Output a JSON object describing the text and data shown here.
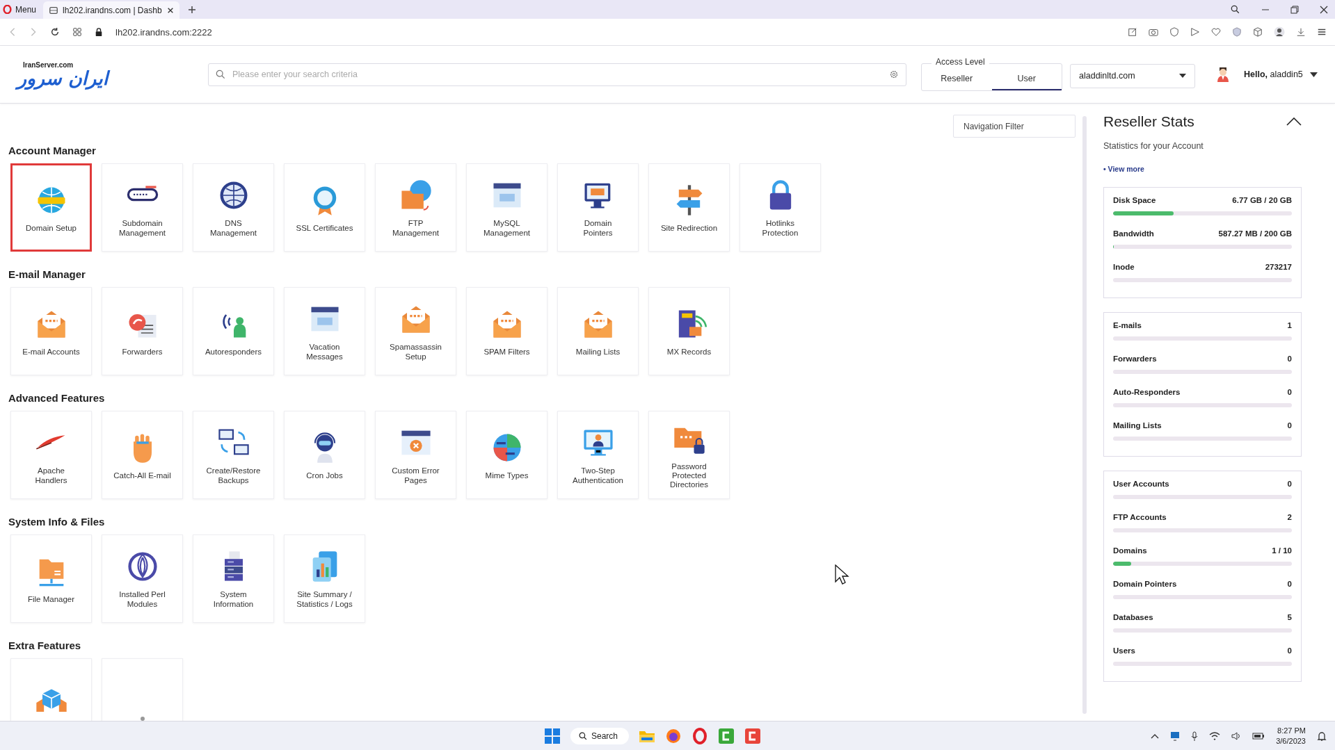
{
  "browser": {
    "menu_label": "Menu",
    "tab_title": "lh202.irandns.com | Dashb",
    "url": "lh202.irandns.com:2222"
  },
  "header": {
    "logo_caption": "IranServer.com",
    "logo_text": "ایران سرور",
    "search": {
      "placeholder": "Please enter your search criteria"
    },
    "access_level": {
      "legend": "Access Level",
      "options": [
        {
          "label": "Reseller",
          "selected": false
        },
        {
          "label": "User",
          "selected": true
        }
      ]
    },
    "domain_select": {
      "value": "aladdinltd.com"
    },
    "greeting": "**Hello,** aladdin5"
  },
  "navigation_filter": {
    "placeholder": "Navigation Filter"
  },
  "sections": [
    {
      "title": "Account Manager",
      "items": [
        {
          "label": "Domain Setup",
          "selected": true
        },
        {
          "label": "Subdomain Management",
          "selected": false
        },
        {
          "label": "DNS Management",
          "selected": false
        },
        {
          "label": "SSL Certificates",
          "selected": false
        },
        {
          "label": "FTP Management",
          "selected": false
        },
        {
          "label": "MySQL Management",
          "selected": false
        },
        {
          "label": "Domain Pointers",
          "selected": false
        },
        {
          "label": "Site Redirection",
          "selected": false
        },
        {
          "label": "Hotlinks Protection",
          "selected": false
        }
      ]
    },
    {
      "title": "E-mail Manager",
      "items": [
        {
          "label": "E-mail Accounts",
          "selected": false
        },
        {
          "label": "Forwarders",
          "selected": false
        },
        {
          "label": "Autoresponders",
          "selected": false
        },
        {
          "label": "Vacation Messages",
          "selected": false
        },
        {
          "label": "Spamassassin Setup",
          "selected": false
        },
        {
          "label": "SPAM Filters",
          "selected": false
        },
        {
          "label": "Mailing Lists",
          "selected": false
        },
        {
          "label": "MX Records",
          "selected": false
        }
      ]
    },
    {
      "title": "Advanced Features",
      "items": [
        {
          "label": "Apache Handlers",
          "selected": false
        },
        {
          "label": "Catch-All E-mail",
          "selected": false
        },
        {
          "label": "Create/Restore Backups",
          "selected": false
        },
        {
          "label": "Cron Jobs",
          "selected": false
        },
        {
          "label": "Custom Error Pages",
          "selected": false
        },
        {
          "label": "Mime Types",
          "selected": false
        },
        {
          "label": "Two-Step Authentication",
          "selected": false
        },
        {
          "label": "Password Protected Directories",
          "selected": false
        }
      ]
    },
    {
      "title": "System Info & Files",
      "items": [
        {
          "label": "File Manager",
          "selected": false
        },
        {
          "label": "Installed Perl Modules",
          "selected": false
        },
        {
          "label": "System Information",
          "selected": false
        },
        {
          "label": "Site Summary / Statistics / Logs",
          "selected": false
        }
      ]
    },
    {
      "title": "Extra Features",
      "items": [
        {
          "selected": false
        },
        {
          "selected": false
        }
      ]
    }
  ],
  "stats_panel": {
    "title": "Reseller Stats",
    "subtitle": "Statistics for your Account",
    "link": "• View more",
    "groups": [
      {
        "rows": [
          {
            "label": "Disk Space",
            "value": "6.77 GB / 20 GB",
            "level": 0.34
          },
          {
            "label": "Bandwidth",
            "value": "587.27 MB / 200 GB",
            "level": 0.003
          },
          {
            "label": "Inode",
            "value": "273217",
            "level": 0
          }
        ]
      },
      {
        "rows": [
          {
            "label": "E-mails",
            "value": "1",
            "level": 0
          },
          {
            "label": "Forwarders",
            "value": "0",
            "level": 0
          },
          {
            "label": "Auto-Responders",
            "value": "0",
            "level": 0
          },
          {
            "label": "Mailing Lists",
            "value": "0",
            "level": 0
          }
        ]
      },
      {
        "rows": [
          {
            "label": "User Accounts",
            "value": "0",
            "level": 0
          },
          {
            "label": "FTP Accounts",
            "value": "2",
            "level": 0
          },
          {
            "label": "Domains",
            "value": "1 / 10",
            "level": 0.1
          },
          {
            "label": "Domain Pointers",
            "value": "0",
            "level": 0
          },
          {
            "label": "Databases",
            "value": "5",
            "level": 0
          },
          {
            "label": "Users",
            "value": "0",
            "level": 0
          }
        ]
      }
    ]
  },
  "taskbar": {
    "search_label": "Search",
    "time": "8:27 PM",
    "date": "3/6/2023"
  }
}
